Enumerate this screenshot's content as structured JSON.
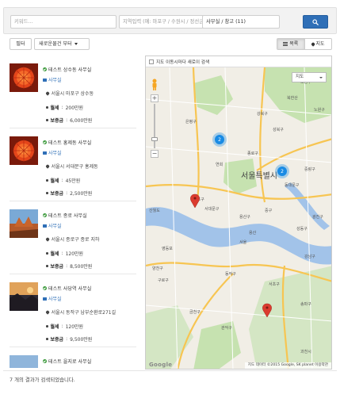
{
  "search": {
    "keyword_placeholder": "키워드...",
    "area_placeholder": "지역입력 (예: 마포구 / 수원시 / 정선군)",
    "category_value": "사무실 / 창고 (11)",
    "search_icon": "search-icon"
  },
  "toolbar": {
    "filter_label": "필터",
    "sort_label": "새로운물건 부터",
    "view_list_label": "목록",
    "view_map_label": "지도"
  },
  "listings": [
    {
      "title": "테스트 상수동 사무실",
      "category": "사무실",
      "address": "서울시 마포구 상수동",
      "rent_label": "월세",
      "rent_value": "200만원",
      "deposit_label": "보증금",
      "deposit_value": "6,000만원",
      "thumb": "red-flower"
    },
    {
      "title": "테스트 홍제동 사무실",
      "category": "사무실",
      "address": "서울시 서대문구 홍제동",
      "rent_label": "월세",
      "rent_value": "45만원",
      "deposit_label": "보증금",
      "deposit_value": "2,500만원",
      "thumb": "red-flower"
    },
    {
      "title": "테스트 종로 사무실",
      "category": "사무실",
      "address": "서울시 종로구 종로 지하",
      "rent_label": "월세",
      "rent_value": "120만원",
      "deposit_label": "보증금",
      "deposit_value": "8,500만원",
      "thumb": "desert"
    },
    {
      "title": "테스트 사당역 사무실",
      "category": "사무실",
      "address": "서울시 동작구 남부순환로271길",
      "rent_label": "월세",
      "rent_value": "120만원",
      "deposit_label": "보증금",
      "deposit_value": "9,500만원",
      "thumb": "sunset"
    },
    {
      "title": "테스트 을지로 사무실",
      "category": "",
      "address": "",
      "rent_label": "",
      "rent_value": "",
      "deposit_label": "",
      "deposit_value": "",
      "thumb": "sky"
    }
  ],
  "map": {
    "search_on_move_label": "지도 이동시마다 새로이 검색",
    "map_type_label": "지도",
    "attribution": "지도 데이터 ©2015 Google, SK planet   이용약관",
    "logo": "Google",
    "city_label": "서울특별시",
    "cluster_counts": [
      "2",
      "2"
    ],
    "place_labels": [
      "북한산",
      "연희",
      "마포구",
      "용산구",
      "서초구",
      "성북구",
      "강남구",
      "동작구",
      "관악구",
      "영등포",
      "구로구",
      "과천시",
      "산월도",
      "서대문구",
      "종로구",
      "성동구",
      "광진구",
      "송파구",
      "중랑구",
      "동대문구",
      "노원구",
      "도봉구",
      "강북구",
      "은평구",
      "양천구",
      "금천구",
      "용산",
      "서울",
      "중구"
    ],
    "colors": {
      "river": "#a2c3e9",
      "land": "#f1eee6",
      "highway": "#f7c552",
      "park": "#c6e2b0",
      "cluster": "#1a8be4",
      "marker": "#db3b2f"
    }
  },
  "footer": {
    "results_text": "7 개의 결과가 검색되었습니다."
  }
}
